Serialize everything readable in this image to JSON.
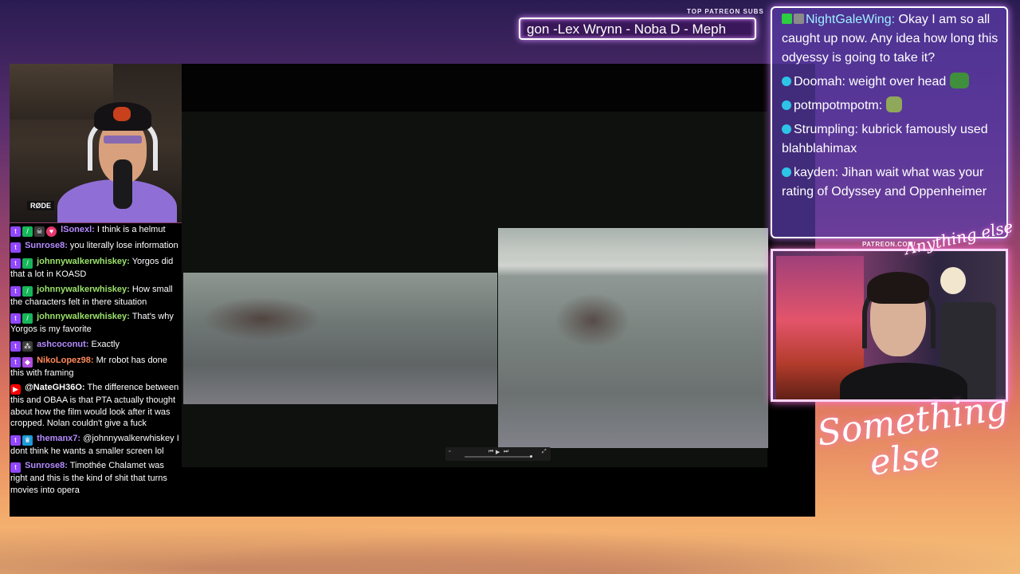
{
  "patreon_ticker": {
    "label": "TOP PATREON SUBS",
    "text": "gon -Lex Wrynn -  Noba D - Meph"
  },
  "webcam_left": {
    "mic_brand": "RØDE"
  },
  "chat_left": {
    "messages": [
      {
        "user": "lSonexl:",
        "text": "I think is a helmut",
        "color": "#b58bff"
      },
      {
        "user": "Sunrose8:",
        "text": "you literally lose information",
        "color": "#b58bff"
      },
      {
        "user": "johnnywalkerwhiskey:",
        "text": "Yorgos did that a lot in KOASD",
        "color": "#9be36a"
      },
      {
        "user": "johnnywalkerwhiskey:",
        "text": "How small the characters felt in there situation",
        "color": "#9be36a"
      },
      {
        "user": "johnnywalkerwhiskey:",
        "text": "That's why Yorgos is my favorite",
        "color": "#9be36a"
      },
      {
        "user": "ashcoconut:",
        "text": "Exactly",
        "color": "#b58bff"
      },
      {
        "user": "NikoLopez98:",
        "text": "Mr robot has done this with framing",
        "color": "#ff8a5c"
      },
      {
        "user": "@NateGH36O:",
        "text": "The difference between this and OBAA is that PTA actually thought about how the film would look after it was cropped. Nolan couldn't give a fuck",
        "color": "#ffffff"
      },
      {
        "user": "themanx7:",
        "text": "@johnnywalkerwhiskey I dont think he wants a smaller screen lol",
        "color": "#b58bff"
      },
      {
        "user": "Sunrose8:",
        "text": "Timothée Chalamet was right and this is the kind of shit that turns movies into opera",
        "color": "#b58bff"
      }
    ]
  },
  "chat_right": {
    "messages": [
      {
        "user": "NightGaleWing:",
        "text": "Okay I am so all caught up now. Any idea how long this odyessy is going to take it?"
      },
      {
        "user": "Doomah:",
        "text": "weight over head"
      },
      {
        "user": "potmpotmpotm:",
        "text": ""
      },
      {
        "user": "Strumpling:",
        "text": "kubrick famously used blahblahimax"
      },
      {
        "user": "kayden:",
        "text": "Jihan wait what was your rating of Odyssey and Oppenheimer"
      }
    ]
  },
  "overlay": {
    "patreon_url": "PATREON.COM/",
    "brand_small": "Anything else",
    "brand_large_line1": "Something",
    "brand_large_line2": "else"
  },
  "colors": {
    "accent_glow": "#c57dff",
    "chat_panel": "#5a3caa",
    "twitch_purple": "#9147ff"
  }
}
